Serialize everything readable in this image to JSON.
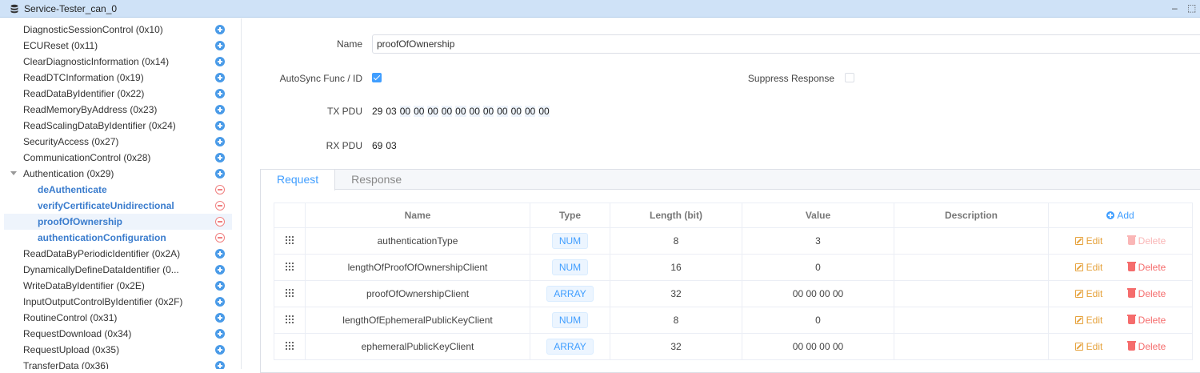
{
  "window": {
    "title": "Service-Tester_can_0",
    "minimize_glyph": "–",
    "maximize_glyph": "⬚"
  },
  "sidebar": {
    "items": [
      {
        "label": "DiagnosticSessionControl (0x10)"
      },
      {
        "label": "ECUReset (0x11)"
      },
      {
        "label": "ClearDiagnosticInformation (0x14)"
      },
      {
        "label": "ReadDTCInformation (0x19)"
      },
      {
        "label": "ReadDataByIdentifier (0x22)"
      },
      {
        "label": "ReadMemoryByAddress (0x23)"
      },
      {
        "label": "ReadScalingDataByIdentifier (0x24)"
      },
      {
        "label": "SecurityAccess (0x27)"
      },
      {
        "label": "CommunicationControl (0x28)"
      },
      {
        "label": "Authentication (0x29)"
      },
      {
        "label": "deAuthenticate"
      },
      {
        "label": "verifyCertificateUnidirectional"
      },
      {
        "label": "proofOfOwnership"
      },
      {
        "label": "authenticationConfiguration"
      },
      {
        "label": "ReadDataByPeriodicIdentifier (0x2A)"
      },
      {
        "label": "DynamicallyDefineDataIdentifier (0..."
      },
      {
        "label": "WriteDataByIdentifier (0x2E)"
      },
      {
        "label": "InputOutputControlByIdentifier (0x2F)"
      },
      {
        "label": "RoutineControl (0x31)"
      },
      {
        "label": "RequestDownload (0x34)"
      },
      {
        "label": "RequestUpload (0x35)"
      },
      {
        "label": "TransferData (0x36)"
      }
    ]
  },
  "form": {
    "name_label": "Name",
    "name_value": "proofOfOwnership",
    "autosync_label": "AutoSync Func / ID",
    "autosync_checked": true,
    "suppress_label": "Suppress Response",
    "suppress_checked": false,
    "tx_label": "TX PDU",
    "tx_bytes": [
      "29",
      "03",
      "00",
      "00",
      "00",
      "00",
      "00",
      "00",
      "00",
      "00",
      "00",
      "00",
      "00"
    ],
    "rx_label": "RX PDU",
    "rx_bytes": [
      "69",
      "03"
    ]
  },
  "tabs": [
    {
      "label": "Request",
      "active": true
    },
    {
      "label": "Response",
      "active": false
    }
  ],
  "table": {
    "headers": {
      "name": "Name",
      "type": "Type",
      "length": "Length (bit)",
      "value": "Value",
      "description": "Description",
      "add": "Add"
    },
    "edit_label": "Edit",
    "delete_label": "Delete",
    "rows": [
      {
        "name": "authenticationType",
        "type": "NUM",
        "length": "8",
        "value": "3",
        "description": "",
        "delete_disabled": true
      },
      {
        "name": "lengthOfProofOfOwnershipClient",
        "type": "NUM",
        "length": "16",
        "value": "0",
        "description": "",
        "delete_disabled": false
      },
      {
        "name": "proofOfOwnershipClient",
        "type": "ARRAY",
        "length": "32",
        "value": "00 00 00 00",
        "description": "",
        "delete_disabled": false
      },
      {
        "name": "lengthOfEphemeralPublicKeyClient",
        "type": "NUM",
        "length": "8",
        "value": "0",
        "description": "",
        "delete_disabled": false
      },
      {
        "name": "ephemeralPublicKeyClient",
        "type": "ARRAY",
        "length": "32",
        "value": "00 00 00 00",
        "description": "",
        "delete_disabled": false
      }
    ]
  },
  "colors": {
    "accent": "#409eff",
    "edit": "#e6a23c",
    "delete": "#f56c6c",
    "titlebar": "#cfe2f7"
  }
}
